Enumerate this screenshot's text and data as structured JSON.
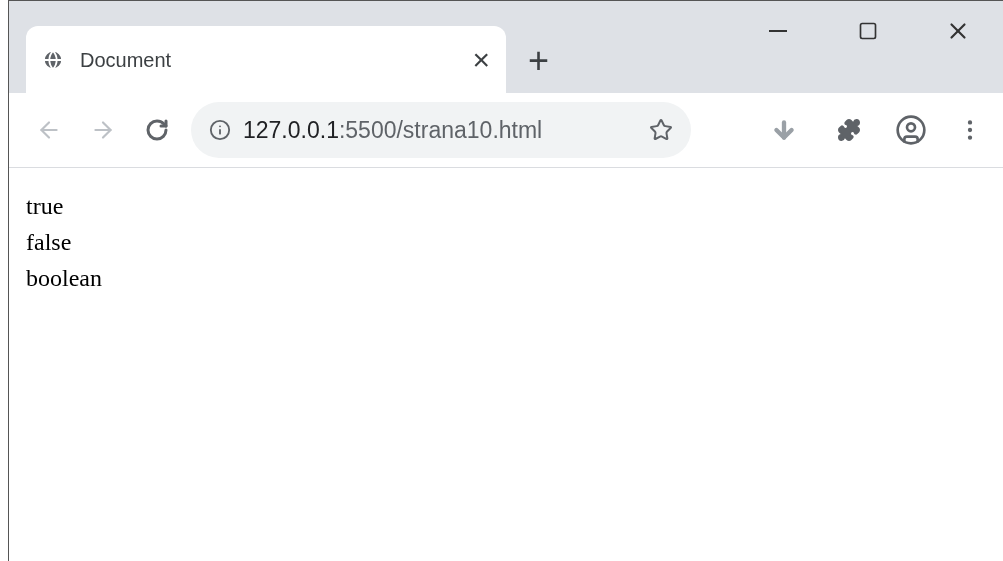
{
  "tab": {
    "title": "Document",
    "close": "×",
    "selected": true
  },
  "new_tab": "+",
  "address_bar": {
    "host": "127.0.0.1",
    "path": ":5500/strana10.html"
  },
  "page_lines": [
    "true",
    "false",
    "boolean"
  ]
}
